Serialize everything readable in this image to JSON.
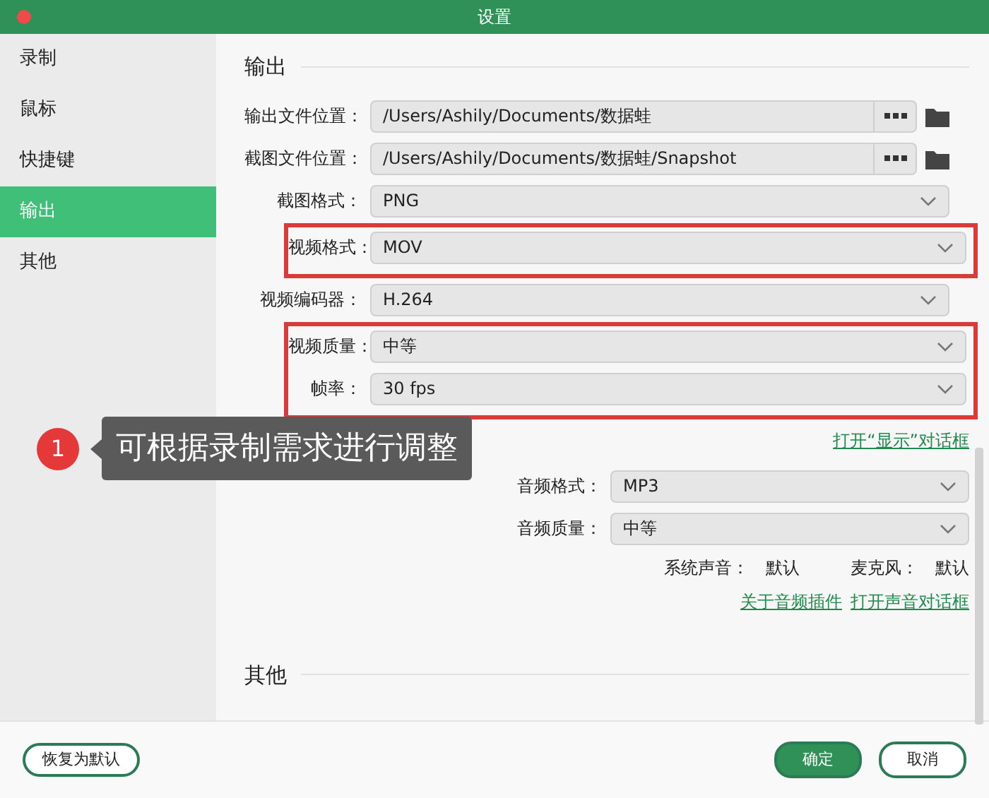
{
  "window": {
    "title": "设置"
  },
  "sidebar": {
    "items": [
      {
        "label": "录制",
        "selected": false
      },
      {
        "label": "鼠标",
        "selected": false
      },
      {
        "label": "快捷键",
        "selected": false
      },
      {
        "label": "输出",
        "selected": true
      },
      {
        "label": "其他",
        "selected": false
      }
    ]
  },
  "output_section": {
    "title": "输出",
    "fields": [
      {
        "kind": "path",
        "label": "输出文件位置：",
        "value": "/Users/Ashily/Documents/数据蛙",
        "highlighted": false
      },
      {
        "kind": "path",
        "label": "截图文件位置：",
        "value": "/Users/Ashily/Documents/数据蛙/Snapshot",
        "highlighted": false
      },
      {
        "kind": "select",
        "label": "截图格式：",
        "value": "PNG",
        "highlighted": false
      },
      {
        "kind": "select",
        "label": "视频格式：",
        "value": "MOV",
        "highlighted": true
      },
      {
        "kind": "select",
        "label": "视频编码器：",
        "value": "H.264",
        "highlighted": false
      },
      {
        "kind": "select",
        "label": "视频质量：",
        "value": "中等",
        "highlighted": true
      },
      {
        "kind": "select",
        "label": "帧率：",
        "value": "30 fps",
        "highlighted": true
      }
    ],
    "display_link": "打开“显示”对话框",
    "audio_fields": [
      {
        "label": "音频格式：",
        "value": "MP3"
      },
      {
        "label": "音频质量：",
        "value": "中等"
      }
    ],
    "audio_status": [
      {
        "label": "系统声音：",
        "value": "默认"
      },
      {
        "label": "麦克风：",
        "value": "默认"
      }
    ],
    "audio_links": [
      "关于音频插件",
      "打开声音对话框"
    ]
  },
  "other_section": {
    "title": "其他"
  },
  "callout": {
    "number": "1",
    "text": "可根据录制需求进行调整"
  },
  "footer": {
    "reset_button": "恢复为默认",
    "buttons": [
      {
        "label": "确定",
        "primary": true
      },
      {
        "label": "取消",
        "primary": false
      }
    ]
  }
}
